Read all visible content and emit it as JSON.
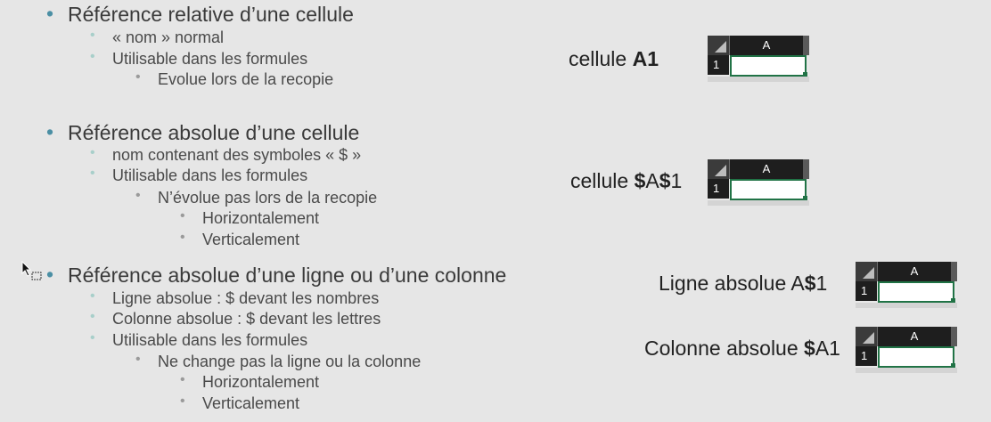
{
  "section1": {
    "title": "Référence relative d’une cellule",
    "items": [
      "« nom » normal",
      "Utilisable dans les formules"
    ],
    "sub": [
      "Evolue lors de la recopie"
    ],
    "label_prefix": "cellule ",
    "label_ref": "A1"
  },
  "section2": {
    "title": "Référence absolue d’une cellule",
    "items": [
      "nom contenant des symboles « $ »",
      "Utilisable dans les formules"
    ],
    "sub": [
      "N’évolue pas lors de la recopie"
    ],
    "subsub": [
      "Horizontalement",
      "Verticalement"
    ],
    "label_prefix": "cellule ",
    "label_d1": "$",
    "label_mid": "A",
    "label_d2": "$",
    "label_end": "1"
  },
  "section3": {
    "title": "Référence absolue d’une ligne ou d’une colonne",
    "items": [
      "Ligne absolue : $  devant les nombres",
      "Colonne absolue : $  devant les lettres",
      "Utilisable dans les formules"
    ],
    "sub": [
      "Ne change pas la ligne ou la colonne"
    ],
    "subsub": [
      "Horizontalement",
      "Verticalement"
    ],
    "line_label_prefix": "Ligne absolue A",
    "line_label_dollar": "$",
    "line_label_end": "1",
    "col_label_prefix": "Colonne absolue ",
    "col_label_dollar": "$",
    "col_label_end": "A1"
  },
  "bullet_char": "•",
  "grid": {
    "col_header": "A",
    "row_header": "1"
  },
  "colors": {
    "accent_bullet": "#4b8fa4",
    "excel_green": "#217346",
    "background": "#e6e6e6"
  }
}
